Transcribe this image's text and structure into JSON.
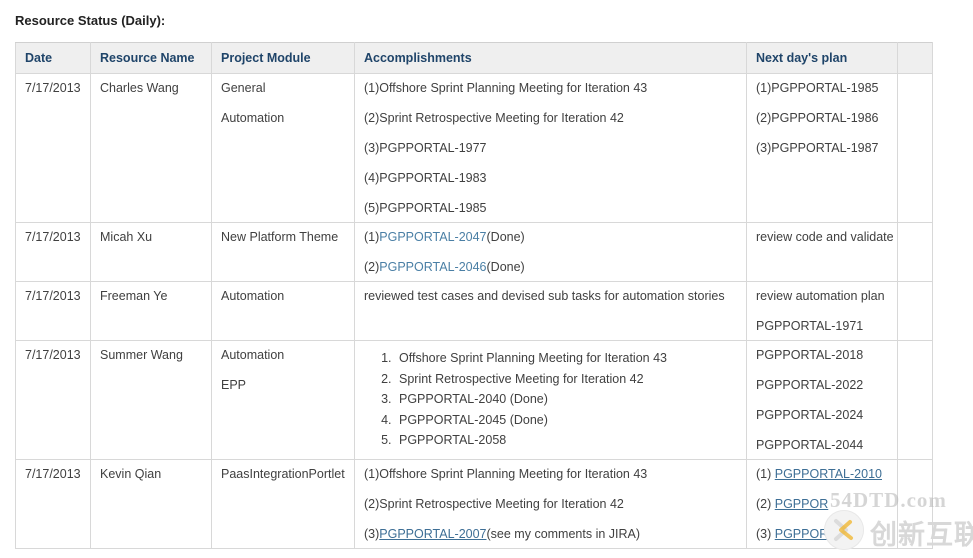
{
  "page": {
    "title": "Resource Status (Daily):"
  },
  "table": {
    "headers": [
      "Date",
      "Resource Name",
      "Project Module",
      "Accomplishments",
      "Next day's plan",
      ""
    ],
    "rows": [
      {
        "date": "7/17/2013",
        "resource": "Charles Wang",
        "modules": [
          "General",
          "Automation"
        ],
        "accomplishments": [
          "(1)Offshore Sprint Planning Meeting for Iteration 43",
          "(2)Sprint Retrospective Meeting for Iteration 42",
          "(3)PGPPORTAL-1977",
          "(4)PGPPORTAL-1983",
          "(5)PGPPORTAL-1985"
        ],
        "plan": [
          "(1)PGPPORTAL-1985",
          "(2)PGPPORTAL-1986",
          "(3)PGPPORTAL-1987"
        ],
        "extra": ""
      },
      {
        "date": "7/17/2013",
        "resource": "Micah Xu",
        "modules": [
          "New Platform Theme"
        ],
        "accomplishments_rich": [
          {
            "prefix": "(1)",
            "link": "PGPPORTAL-2047",
            "suffix": "(Done)"
          },
          {
            "prefix": "(2)",
            "link": "PGPPORTAL-2046",
            "suffix": "(Done)"
          }
        ],
        "plan": [
          "review code and validate"
        ],
        "extra": ""
      },
      {
        "date": "7/17/2013",
        "resource": "Freeman Ye",
        "modules": [
          "Automation"
        ],
        "accomplishments": [
          "reviewed test cases and devised sub tasks for automation stories"
        ],
        "plan": [
          "review automation plan",
          "PGPPORTAL-1971"
        ],
        "extra": ""
      },
      {
        "date": "7/17/2013",
        "resource": "Summer Wang",
        "modules": [
          "Automation",
          "EPP"
        ],
        "accomplishments_ordered": [
          "Offshore Sprint Planning Meeting for Iteration 43",
          "Sprint Retrospective Meeting for Iteration 42",
          "PGPPORTAL-2040 (Done)",
          "PGPPORTAL-2045 (Done)",
          "PGPPORTAL-2058"
        ],
        "plan": [
          "PGPPORTAL-2018",
          "PGPPORTAL-2022",
          "PGPPORTAL-2024",
          "PGPPORTAL-2044"
        ],
        "extra": ""
      },
      {
        "date": "7/17/2013",
        "resource": "Kevin Qian",
        "modules": [
          "PaasIntegrationPortlet"
        ],
        "accomplishments_rich": [
          {
            "prefix": "(1)Offshore Sprint Planning Meeting for Iteration 43",
            "link": "",
            "suffix": ""
          },
          {
            "prefix": "(2)Sprint Retrospective Meeting for Iteration 42",
            "link": "",
            "suffix": ""
          },
          {
            "prefix": "(3)",
            "link": "PGPPORTAL-2007",
            "suffix": "(see my comments in JIRA)"
          }
        ],
        "plan_rich": [
          {
            "prefix": "(1) ",
            "link": "PGPPORTAL-2010",
            "suffix": ""
          },
          {
            "prefix": "(2) ",
            "link": "PGPPOR",
            "suffix": ""
          },
          {
            "prefix": "(3) ",
            "link": "PGPPOR",
            "suffix": ""
          }
        ],
        "extra": ""
      }
    ]
  },
  "watermark": {
    "faint_text": "54DTD.com",
    "cn_text": "创新互联"
  },
  "colors": {
    "header_text": "#1f4469",
    "header_bg": "#efefef",
    "border": "#d8d8d8",
    "link": "#4a7fa5",
    "body_text": "#404040"
  }
}
